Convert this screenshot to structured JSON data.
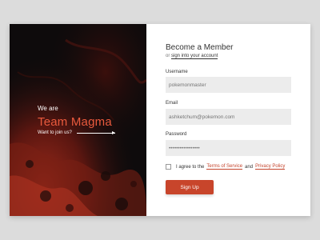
{
  "hero": {
    "greeting": "We are",
    "team_name": "Team Magma",
    "cta": "Want to join us?"
  },
  "form": {
    "title": "Become a Member",
    "signin_prefix": "or",
    "signin_link": "sign into your account",
    "username_label": "Username",
    "username_placeholder": "pokemonmaster",
    "email_label": "Email",
    "email_placeholder": "ashketchum@pokemon.com",
    "password_label": "Password",
    "password_placeholder": "•••••••••••••••••",
    "terms_prefix": "I agree to the",
    "terms_link": "Terms of Service",
    "terms_and": "and",
    "privacy_link": "Privacy Policy",
    "submit_label": "Sign Up"
  },
  "colors": {
    "accent": "#c8452b",
    "title_accent": "#ea5a3d",
    "hero_bg": "#0d0a0b"
  }
}
